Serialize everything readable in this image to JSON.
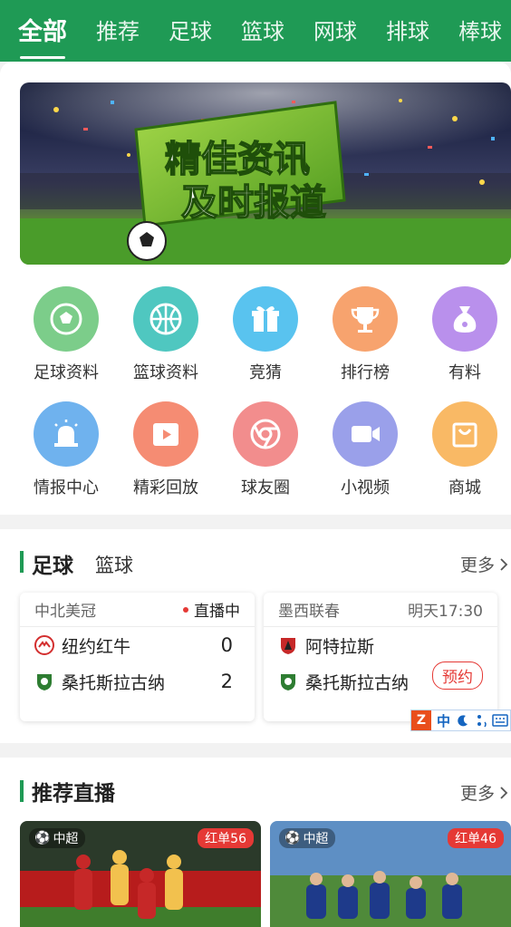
{
  "tabs": [
    "全部",
    "推荐",
    "足球",
    "篮球",
    "网球",
    "排球",
    "棒球"
  ],
  "banner": {
    "line1": "精佳资讯",
    "line2": "及时报道"
  },
  "grid": [
    {
      "label": "足球资料",
      "color": "#7ccd8a",
      "icon": "soccer-ball-icon"
    },
    {
      "label": "篮球资料",
      "color": "#4fc7c0",
      "icon": "basketball-icon"
    },
    {
      "label": "竞猜",
      "color": "#59c3ef",
      "icon": "gift-icon"
    },
    {
      "label": "排行榜",
      "color": "#f7a36e",
      "icon": "trophy-icon"
    },
    {
      "label": "有料",
      "color": "#b990ec",
      "icon": "money-bag-icon"
    },
    {
      "label": "情报中心",
      "color": "#6fb2ee",
      "icon": "alarm-light-icon"
    },
    {
      "label": "精彩回放",
      "color": "#f58c73",
      "icon": "video-play-icon"
    },
    {
      "label": "球友圈",
      "color": "#f28d8d",
      "icon": "circle-icon"
    },
    {
      "label": "小视频",
      "color": "#9aa0ea",
      "icon": "video-camera-icon"
    },
    {
      "label": "商城",
      "color": "#f9b965",
      "icon": "shopping-bag-icon"
    }
  ],
  "matches_section": {
    "title": "足球",
    "sub": "篮球",
    "more": "更多",
    "matches": [
      {
        "league": "中北美冠",
        "status": "直播中",
        "home": "纽约红牛",
        "away": "桑托斯拉古纳",
        "home_score": "0",
        "away_score": "2"
      },
      {
        "league": "墨西联春",
        "status": "明天17:30",
        "home": "阿特拉斯",
        "away": "桑托斯拉古纳",
        "action": "预约"
      }
    ]
  },
  "live_section": {
    "title": "推荐直播",
    "more": "更多",
    "items": [
      {
        "league": "中超",
        "badge": "红单56"
      },
      {
        "league": "中超",
        "badge": "红单46"
      }
    ]
  },
  "ime": {
    "label": "中"
  }
}
